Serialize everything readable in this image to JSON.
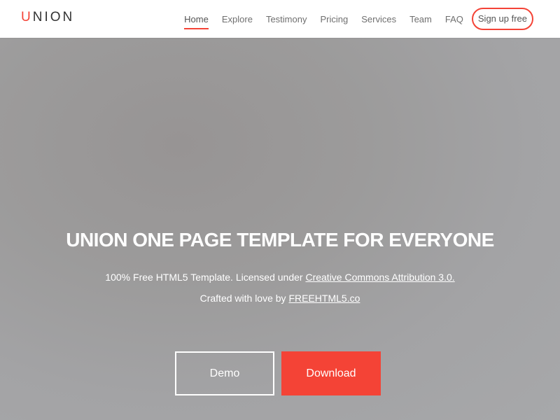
{
  "brand": {
    "logo_first_letter": "U",
    "logo_rest": "NION",
    "accent_color": "#f44336"
  },
  "nav": {
    "items": [
      {
        "label": "Home",
        "active": true
      },
      {
        "label": "Explore"
      },
      {
        "label": "Testimony"
      },
      {
        "label": "Pricing"
      },
      {
        "label": "Services"
      },
      {
        "label": "Team"
      },
      {
        "label": "FAQ"
      }
    ],
    "signup_label": "Sign up free"
  },
  "hero": {
    "title": "UNION ONE PAGE TEMPLATE FOR EVERYONE",
    "subtitle_prefix": "100% Free HTML5 Template. Licensed under ",
    "license_link": "Creative Commons Attribution 3.0.",
    "crafted_prefix": "Crafted with love by ",
    "crafted_link": "FREEHTML5.co",
    "demo_label": "Demo",
    "download_label": "Download"
  }
}
